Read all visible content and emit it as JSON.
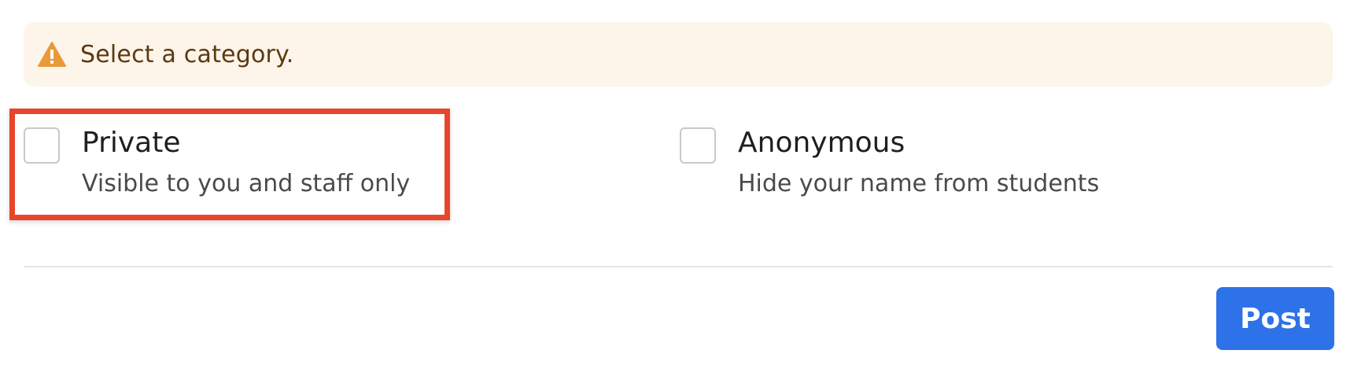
{
  "alert": {
    "icon": "warning-icon",
    "message": "Select a category.",
    "icon_color": "#e89a3a",
    "background": "#fdf4ea"
  },
  "options": {
    "private": {
      "title": "Private",
      "description": "Visible to you and staff only",
      "checked": false
    },
    "anonymous": {
      "title": "Anonymous",
      "description": "Hide your name from students",
      "checked": false
    }
  },
  "highlight_color": "#e8452c",
  "footer": {
    "post_label": "Post",
    "post_color": "#2d72e8"
  }
}
